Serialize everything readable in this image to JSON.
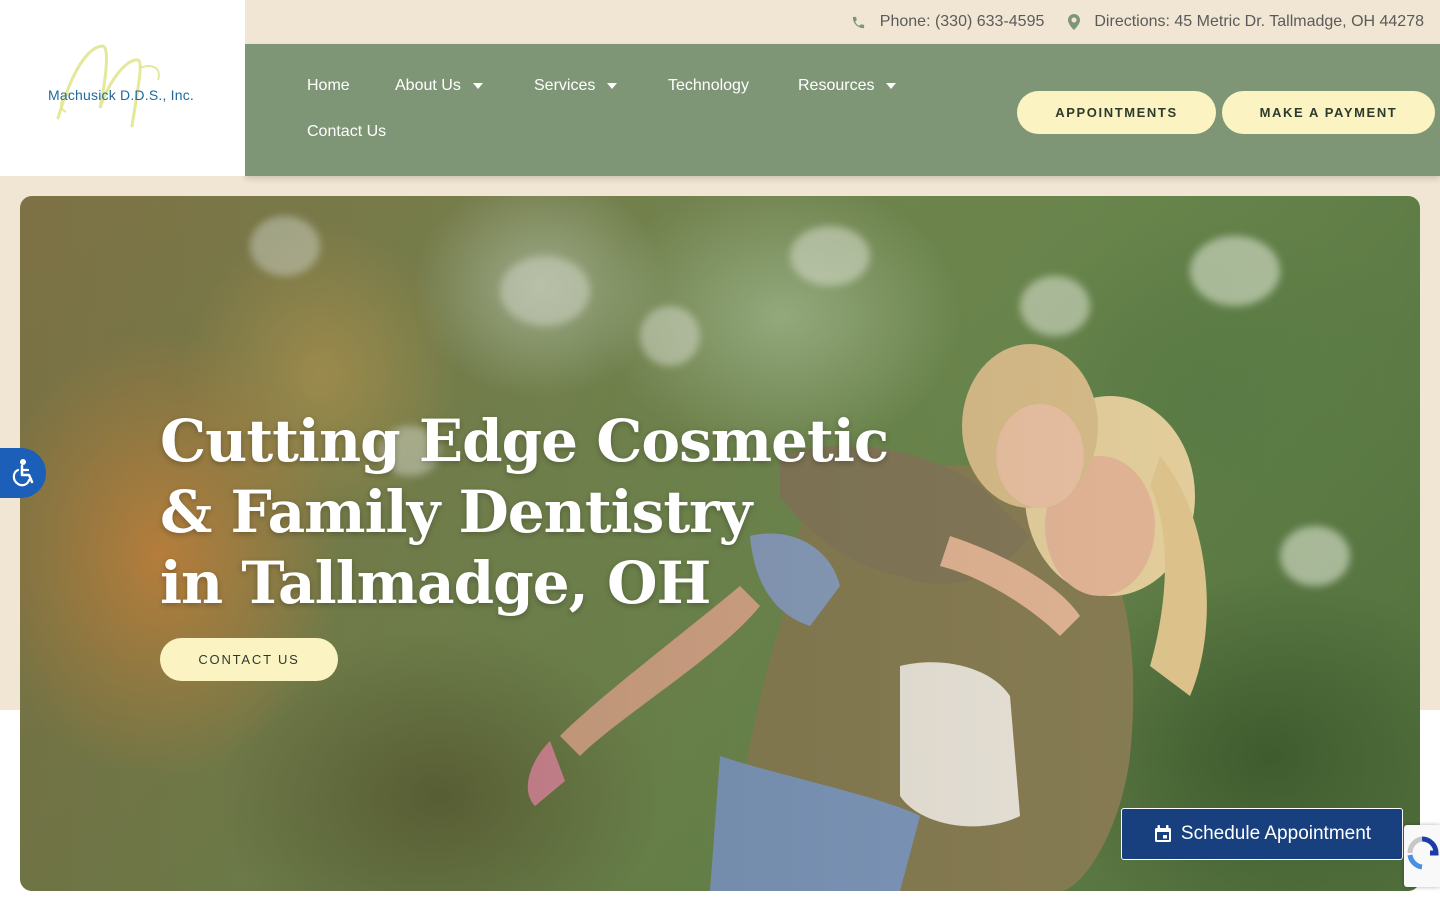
{
  "logo": {
    "text": "Machusick D.D.S., Inc.",
    "monogram_color": "#e3e89a"
  },
  "topbar": {
    "phone_label": "Phone: (330) 633-4595",
    "directions_label": "Directions: 45 Metric Dr. Tallmadge, OH 44278",
    "phone_icon": "phone-icon",
    "pin_icon": "map-pin-icon"
  },
  "nav": {
    "items": [
      {
        "label": "Home",
        "has_dropdown": false
      },
      {
        "label": "About Us",
        "has_dropdown": true
      },
      {
        "label": "Services",
        "has_dropdown": true
      },
      {
        "label": "Technology",
        "has_dropdown": false
      },
      {
        "label": "Resources",
        "has_dropdown": true
      },
      {
        "label": "Contact Us",
        "has_dropdown": false
      }
    ],
    "appointments_label": "APPOINTMENTS",
    "payment_label": "MAKE A PAYMENT"
  },
  "hero": {
    "title_lines": [
      "Cutting Edge Cosmetic",
      "& Family Dentistry",
      "in Tallmadge, OH"
    ],
    "cta_label": "CONTACT US"
  },
  "widgets": {
    "accessibility_icon": "wheelchair-icon",
    "schedule_label": "Schedule Appointment",
    "schedule_icon": "calendar-icon"
  },
  "colors": {
    "nav_bg": "#7f9676",
    "cream_bg": "#f0e6d3",
    "pill_bg": "#fbf4c2",
    "schedule_bg": "#18407f",
    "access_bg": "#1b5fb8"
  }
}
